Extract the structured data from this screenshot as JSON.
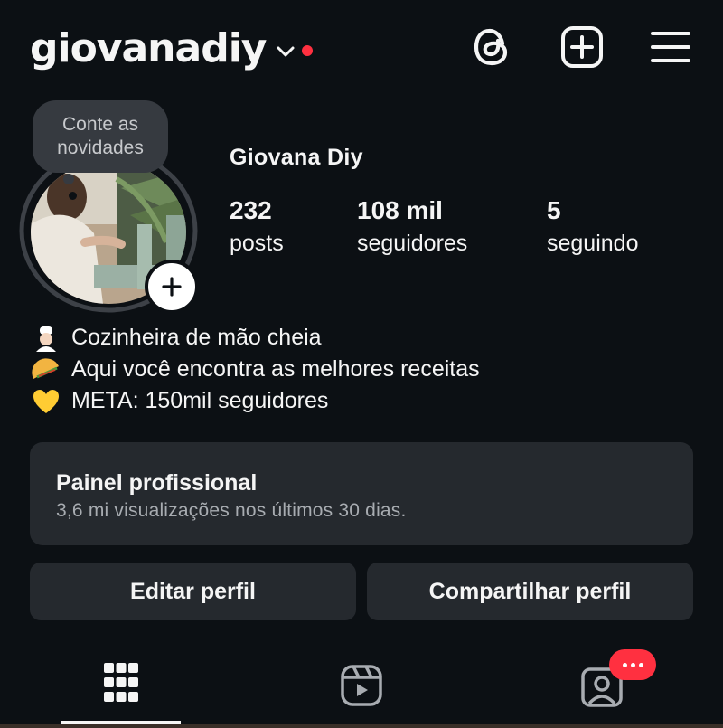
{
  "header": {
    "username": "giovanadiy",
    "icons": {
      "threads": "threads-icon",
      "new_post": "plus-square-icon",
      "menu": "hamburger-menu-icon"
    }
  },
  "note": {
    "line1": "Conte as",
    "line2": "novidades"
  },
  "profile": {
    "full_name": "Giovana Diy",
    "stats": [
      {
        "count": "232",
        "label": "posts"
      },
      {
        "count": "108 mil",
        "label": "seguidores"
      },
      {
        "count": "5",
        "label": "seguindo"
      }
    ],
    "bio": [
      {
        "emoji": "cook-emoji",
        "text": "Cozinheira de mão cheia"
      },
      {
        "emoji": "taco-emoji",
        "text": "Aqui você encontra as melhores receitas"
      },
      {
        "emoji": "yellow-heart-emoji",
        "text": "META: 150mil seguidores"
      }
    ]
  },
  "dashboard": {
    "title": "Painel profissional",
    "subtitle": "3,6 mi visualizações nos últimos 30 dias."
  },
  "buttons": {
    "edit": "Editar perfil",
    "share": "Compartilhar perfil"
  },
  "tabs": [
    "grid-icon",
    "reels-icon",
    "tagged-icon"
  ],
  "colors": {
    "background": "#0c1014",
    "surface": "#25292e",
    "accent_red": "#ff3040",
    "text": "#f5f5f5",
    "muted": "#a8acb1"
  }
}
